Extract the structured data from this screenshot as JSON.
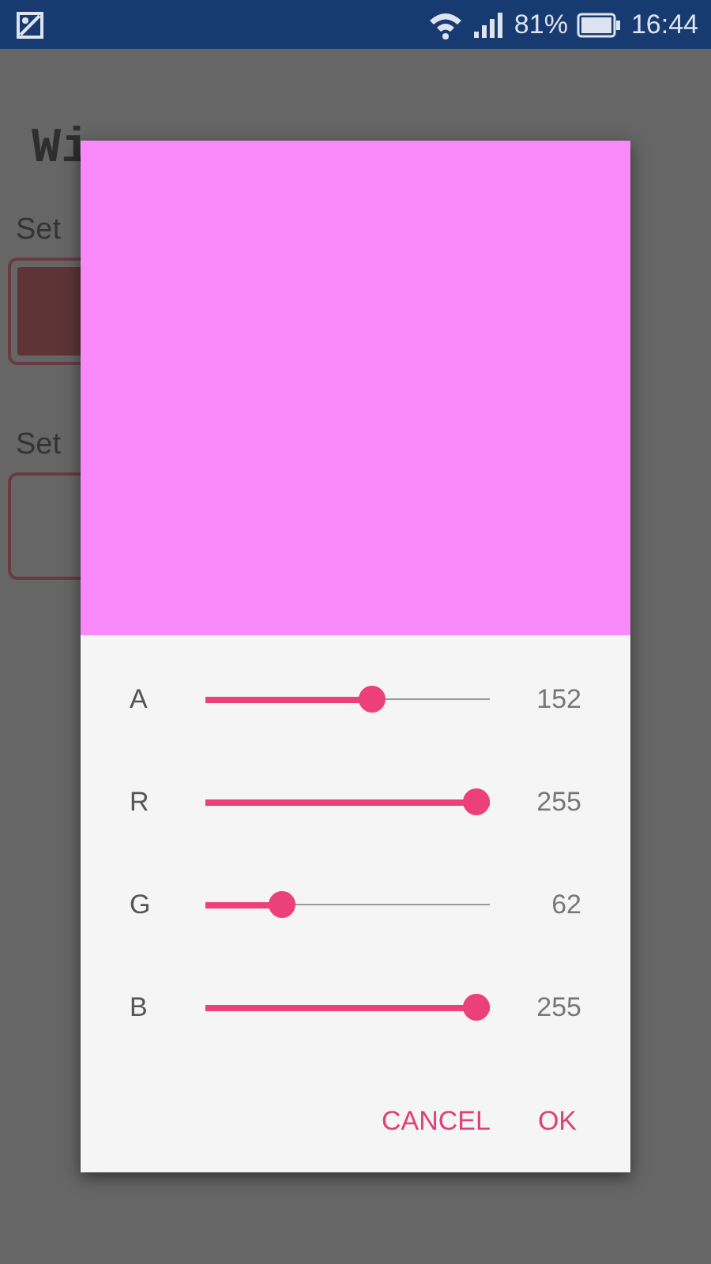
{
  "status_bar": {
    "battery": "81%",
    "time": "16:44"
  },
  "page": {
    "title": "Wi",
    "swatches": [
      {
        "label": "Set",
        "color": "#5e3436"
      },
      {
        "label": "Set"
      }
    ]
  },
  "dialog": {
    "preview": {
      "color": "#f988f9"
    },
    "channels": [
      {
        "name": "A",
        "level": 0.596,
        "reading": "152"
      },
      {
        "name": "R",
        "level": 1,
        "reading": "255"
      },
      {
        "name": "G",
        "level": 0.243,
        "reading": "62"
      },
      {
        "name": "B",
        "level": 1,
        "reading": "255"
      }
    ],
    "buttons": [
      "CANCEL",
      "OK"
    ]
  }
}
